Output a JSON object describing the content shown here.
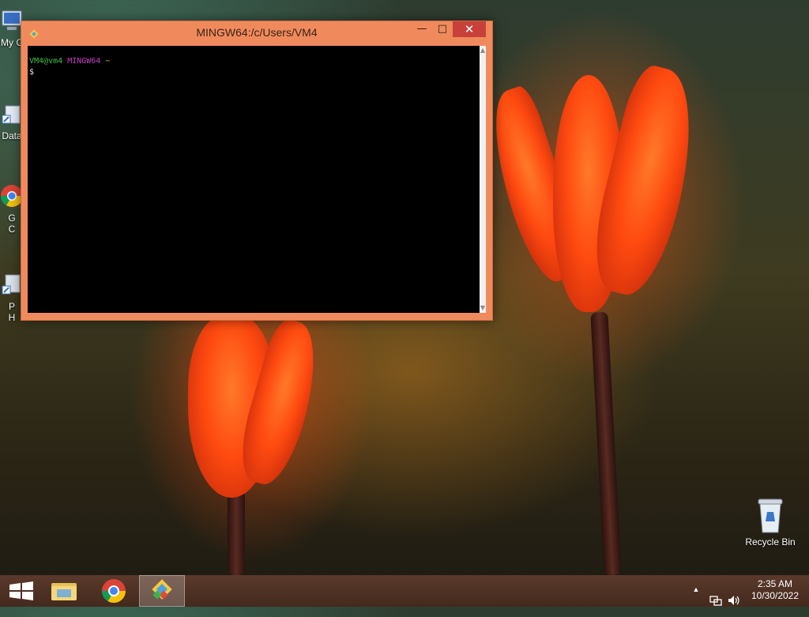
{
  "desktop": {
    "icons": [
      {
        "label": "My C"
      },
      {
        "label": "Data"
      },
      {
        "label": "G\nC"
      },
      {
        "label": "P\nH"
      }
    ],
    "recycle_bin": {
      "label": "Recycle Bin"
    }
  },
  "window": {
    "title": "MINGW64:/c/Users/VM4",
    "min_label": "—",
    "max_label": "□",
    "close_label": "✕",
    "prompt": {
      "user_host": "VM4@vm4",
      "env": "MINGW64",
      "path": "~",
      "symbol": "$"
    },
    "colors": {
      "user_host": "#3fbf3f",
      "env": "#c040c0",
      "path": "#c8b040",
      "text": "#e0e0e0"
    }
  },
  "taskbar": {
    "apps": [
      {
        "name": "start-button",
        "icon": "windows-logo-icon"
      },
      {
        "name": "file-explorer",
        "icon": "folder-icon"
      },
      {
        "name": "chrome",
        "icon": "chrome-icon"
      },
      {
        "name": "git-bash",
        "icon": "git-icon"
      }
    ],
    "tray": {
      "up_arrow": "▲"
    },
    "clock": {
      "time": "2:35 AM",
      "date": "10/30/2022"
    }
  },
  "colors": {
    "window_frame": "#f08a5d",
    "close_button": "#c7403a",
    "terminal_bg": "#000000"
  }
}
